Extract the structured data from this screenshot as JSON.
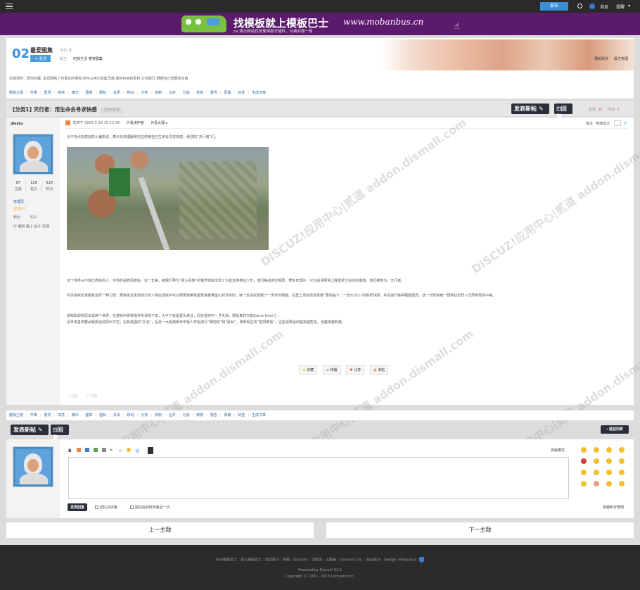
{
  "topbar": {
    "post_button": "发布",
    "messages": "消息",
    "reminder": "提醒",
    "menu_icon": "hamburger-icon",
    "search_icon": "search-icon"
  },
  "banner": {
    "headline": "找模板就上模板巴士",
    "url": "www.mobanbus.cn",
    "subtitle": "ps.演示网站仅有使用部分插件，与商业版一致"
  },
  "forum": {
    "id": "02",
    "name": "最爱图集",
    "today_label": "今日:",
    "today_count": "2",
    "follow_button": "+ 关注",
    "mod_label": "版主:",
    "moderators": "时尚生活 麦芽图集",
    "related_label": "相关版块",
    "moderate_label": "版主管理",
    "description": "本版规则：即你收藏, 发现网络上你喜欢的事物,你可以用它收集灵感,保存有用的素材,计划旅行,晒晒自己想要的东西"
  },
  "mod_actions": [
    "删除主题",
    "升降",
    "置顶",
    "高亮",
    "精华",
    "图章",
    "图标",
    "关闭",
    "移动",
    "分类",
    "复制",
    "合并",
    "分割",
    "修复",
    "警告",
    "屏蔽",
    "标签",
    "生成文章"
  ],
  "thread": {
    "category": "[分类1]",
    "title": "天行者：用生命去寻求快感",
    "copy_link": "[复制链接]",
    "new_post_button": "发表新帖",
    "reply_button": "回复",
    "views_label": "查看:",
    "views": "26",
    "replies_label": "回复:",
    "replies": "0"
  },
  "author": {
    "name": "diestu",
    "stats": [
      {
        "value": "97",
        "label": "主题"
      },
      {
        "value": "129",
        "label": "帖子"
      },
      {
        "value": "520",
        "label": "积分"
      }
    ],
    "group": "管理员",
    "points_label": "积分",
    "points": "520",
    "ip_actions": "IP 编辑 禁止 帖子 清理"
  },
  "post": {
    "time_label": "发表于 2015-5-18 15:12:34",
    "only_author": "只看该作者",
    "view_large": "只看大图",
    "floor": "楼主",
    "electric": "电梯直达",
    "intro": "对于有点恐高症的小编来说，表示无法理解那些总想用自己生命去寻求快感，绝顶的“天行者”们。",
    "para1": "这个世界从不缺乏疯狂的人。可怕的是疯风疯狂。这一年来，被我们称为“極斗民族”的俄罗斯就出现了大批这类疯狂少年，他们挑战高空极限，攀生死置外，只为追寻那肾上腺激素分泌的刺激感。他们被称为：天行者。",
    "para2": "许多游戏玩家都有这样一种习惯：那就是当发现自己的人物在游戏中可以攀爬到某栋建筑或者某座山的顶点时，就一定会挖苦隧汁一步步的攀越，在登上顶点后享受着“居高临下，一览众山小”的刺样快感，并且进行各种截图留念。这一切现突被一群疯狂年轻人迁原到现实中来。",
    "para3": "游戏和现实原本是两个世界，在游戏中即使操作失误掉下去，大不了就是重头来过，而在现实中一旦失误，那就真的只能Game Over了。",
    "para4": "近年来各类着武极限运动层出不穷，先有美国的“扑克”，后来一大批英斯年年轻人开始流行“爬地铁”和“卧轨”，再到现在的“楼顶倒怡”，这些极限运动越来越危险，也越来越刺激。",
    "actions": [
      "收藏",
      "转播",
      "分享",
      "淘帖"
    ],
    "footer_links": [
      "回复",
      "举报"
    ]
  },
  "reply_box": {
    "advanced_mode": "高级模式",
    "submit": "发表回复",
    "option1": "回帖并转播",
    "option2": "回帖后跳转到最后一页",
    "points_rule": "本版积分规则",
    "back_list": "‹ 返回列表"
  },
  "nav": {
    "prev": "上一主题",
    "next": "下一主题"
  },
  "footer": {
    "links": "关于模板巴士 - 加入模板巴士 - 站点统计 - 举报 - Archiver - 手机版 - 小黑屋 - Comsenz Inc. - 站长统计 - Design: Mobanbus",
    "powered": "Powered by Discuz! X3.2",
    "copyright": "Copyright © 2001 - 2013 Comsenz Inc."
  },
  "watermark": "DISCUZ!应用中心|贰道 addon.dismall.com",
  "colors": {
    "accent": "#2c6aa8",
    "banner": "#5b1a6b",
    "dark": "#2a2f3a",
    "topbar": "#2a2a2a"
  }
}
